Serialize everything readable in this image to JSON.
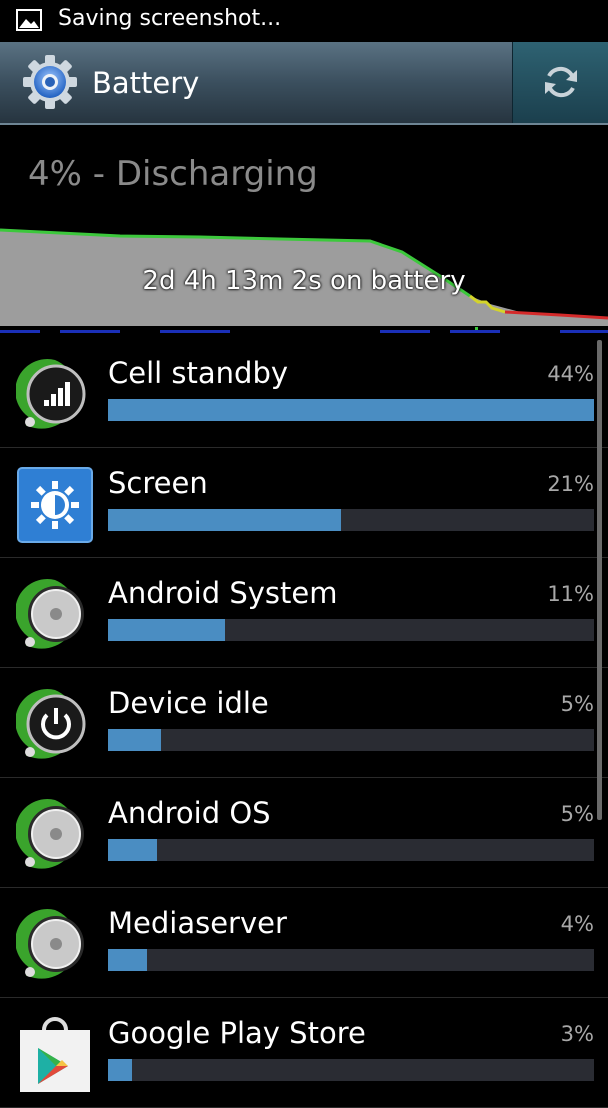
{
  "status_bar": {
    "notification": "Saving screenshot..."
  },
  "action_bar": {
    "title": "Battery",
    "refresh_icon": "refresh-icon"
  },
  "battery": {
    "summary": "4% - Discharging",
    "graph_label": "2d 4h 13m 2s on battery"
  },
  "apps": [
    {
      "name": "Cell standby",
      "percent": "44%",
      "fill": 1.0,
      "icon": "cell-signal-icon"
    },
    {
      "name": "Screen",
      "percent": "21%",
      "fill": 0.48,
      "icon": "brightness-icon"
    },
    {
      "name": "Android System",
      "percent": "11%",
      "fill": 0.24,
      "icon": "android-system-icon"
    },
    {
      "name": "Device idle",
      "percent": "5%",
      "fill": 0.11,
      "icon": "power-icon"
    },
    {
      "name": "Android OS",
      "percent": "5%",
      "fill": 0.1,
      "icon": "android-os-icon"
    },
    {
      "name": "Mediaserver",
      "percent": "4%",
      "fill": 0.08,
      "icon": "mediaserver-icon"
    },
    {
      "name": "Google Play Store",
      "percent": "3%",
      "fill": 0.05,
      "icon": "play-store-icon"
    }
  ],
  "colors": {
    "accent": "#4a8dc2",
    "graph_line": "#3cc83c",
    "low": "#d42a2a"
  }
}
